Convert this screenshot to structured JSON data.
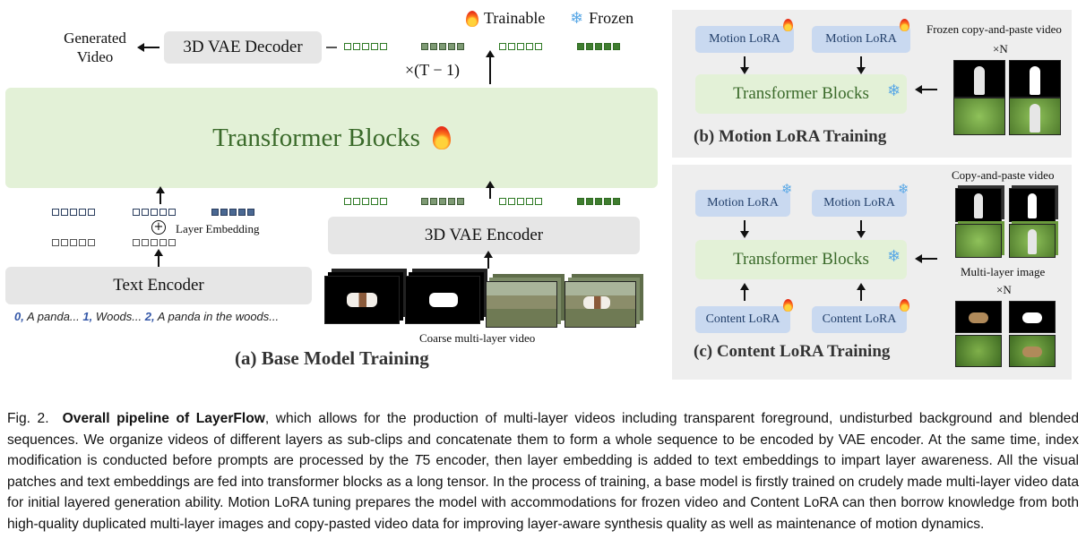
{
  "legend": {
    "trainable": "Trainable",
    "frozen": "Frozen"
  },
  "base": {
    "generated_video": "Generated Video",
    "generated_line1": "Generated",
    "generated_line2": "Video",
    "vae_decoder": "3D VAE Decoder",
    "repeat": "×(T − 1)",
    "transformer": "Transformer Blocks",
    "text_encoder": "Text Encoder",
    "layer_embedding": "Layer Embedding",
    "vae_encoder": "3D VAE Encoder",
    "prompt": [
      {
        "index": "0,",
        "text": " A panda... "
      },
      {
        "index": "1,",
        "text": " Woods... "
      },
      {
        "index": "2,",
        "text": " A panda in the woods..."
      }
    ],
    "coarse_label": "Coarse multi-layer video",
    "title": "(a) Base Model Training"
  },
  "motion": {
    "lora1": "Motion LoRA",
    "lora2": "Motion LoRA",
    "transformer": "Transformer Blocks",
    "video_label": "Frozen copy-and-paste video",
    "times_n": "×N",
    "title": "(b) Motion LoRA Training"
  },
  "content": {
    "motion1": "Motion LoRA",
    "motion2": "Motion LoRA",
    "transformer": "Transformer Blocks",
    "content1": "Content LoRA",
    "content2": "Content LoRA",
    "video_label": "Copy-and-paste video",
    "image_label": "Multi-layer image",
    "times_n": "×N",
    "title": "(c) Content LoRA Training"
  },
  "caption": {
    "fig": "Fig. 2.",
    "bold": "Overall pipeline of LayerFlow",
    "text1": ", which allows for the production of multi-layer videos including transparent foreground, undisturbed background and blended sequences. We organize videos of different layers as sub-clips and concatenate them to form a whole sequence to be encoded by VAE encoder. At the same time, index modification is conducted before prompts are processed by the ",
    "t5": "T",
    "text2": "5 encoder, then layer embedding is added to text embeddings to impart layer awareness. All the visual patches and text embeddings are fed into transformer blocks as a long tensor. In the process of training, a base model is firstly trained on crudely made multi-layer video data for initial layered generation ability. Motion LoRA tuning prepares the model with accommodations for frozen video and Content LoRA can then borrow knowledge from both high-quality duplicated multi-layer images and copy-pasted video data for improving layer-aware synthesis quality as well as maintenance of motion dynamics."
  },
  "colors": {
    "trainable": "#ff6a1a",
    "frozen": "#5aa8e6",
    "lora": "#c9d9f0",
    "transformer": "#e3f1d7",
    "encoder": "#e6e6e6"
  }
}
